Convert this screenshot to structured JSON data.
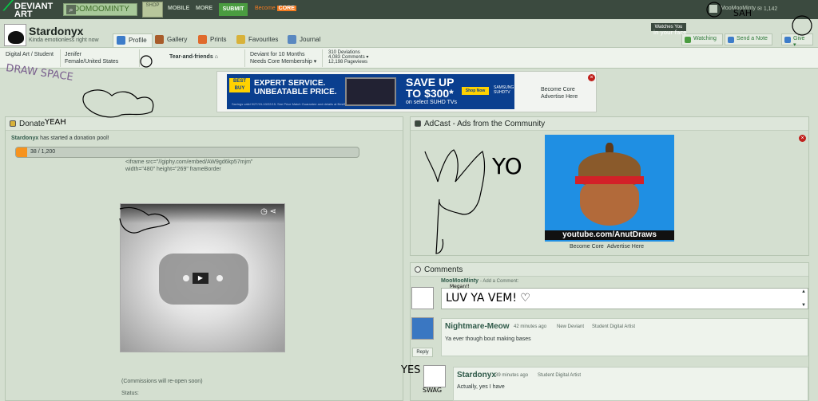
{
  "topbar": {
    "logo_line1": "DEVIANT",
    "logo_line2": "ART",
    "search_value": "MOOMOOMINTY",
    "shop_label": "SHOP",
    "mobile": "MOBILE",
    "more": "MORE",
    "submit": "SUBMIT",
    "become": "Become",
    "core": "CORE",
    "user_name": "MooMooMinty",
    "mail_count": "1,142"
  },
  "profile": {
    "username": "Stardonyx",
    "tagline": "Kinda emotionless right now",
    "watches_you": "Watches You",
    "tabs": [
      {
        "label": "Profile",
        "active": true
      },
      {
        "label": "Gallery"
      },
      {
        "label": "Prints"
      },
      {
        "label": "Favourites"
      },
      {
        "label": "Journal"
      }
    ],
    "watching": "Watching",
    "send_note": "Send a Note",
    "give": "Give"
  },
  "infobar": {
    "cat_line1": "Digital Art / Student",
    "name": "Jenifer",
    "location": "Female/United States",
    "mood": "Tear-and-friends",
    "deviant_for": "Deviant for 10 Months",
    "needs_core": "Needs Core Membership",
    "stats_line1": "310 Deviations",
    "stats_line2": "4,083 Comments",
    "stats_line3": "12,198 Pageviews"
  },
  "top_ad": {
    "brand": "BEST BUY",
    "line1": "EXPERT SERVICE.",
    "line2": "UNBEATABLE PRICE.",
    "fine_print": "Savings valid 9/27/15-10/22/15. See Price Match Guarantee and details at BestBuy.com. ©2015 Best Buy",
    "save": "SAVE UP",
    "save2": "TO $300*",
    "save_on": "on select SUHD TVs",
    "shop_now": "Shop Now",
    "samsung": "SAMSUNG SUHDTV",
    "become_core": "Become Core",
    "advertise": "Advertise Here"
  },
  "donate": {
    "title": "Donate",
    "msg_user": "Stardonyx",
    "msg_rest": " has started a donation pool!",
    "progress_text": "38 / 1,200",
    "progress_value": 38,
    "progress_max": 1200,
    "code_line1": "<iframe src=\"//giphy.com/embed/AW9gd6kp57mjm\"",
    "code_line2": "width=\"480\" height=\"269\" frameBorder",
    "commission": "(Commissions will re-open soon)",
    "status": "Status:"
  },
  "adcast": {
    "title": "AdCast - Ads from the Community",
    "url": "youtube.com/AnutDraws",
    "become_core": "Become Core",
    "advertise": "Advertise Here"
  },
  "comments": {
    "title": "Comments",
    "me": "MooMooMinty",
    "add_comment": "- Add a Comment:",
    "draft": "LUV YA VEM! ♡",
    "items": [
      {
        "user": "Nightmare-Meow",
        "time": "42 minutes ago",
        "role1": "New Deviant",
        "role2": "Student Digital Artist",
        "text": "Ya ever though bout making bases",
        "reply": "Reply"
      },
      {
        "user": "Stardonyx",
        "time": "39 minutes ago",
        "role1": "Student Digital Artist",
        "role2": "",
        "text": "Actually, yes I have"
      }
    ]
  },
  "scribbles": {
    "draw_space": "DRAW SPACE",
    "yeah": "YEAH",
    "yo": "YO",
    "sah": "SAH",
    "in_yaur_face": "in your face",
    "yes": "YES",
    "swag": "SWAG",
    "megan": "Megan!!"
  }
}
